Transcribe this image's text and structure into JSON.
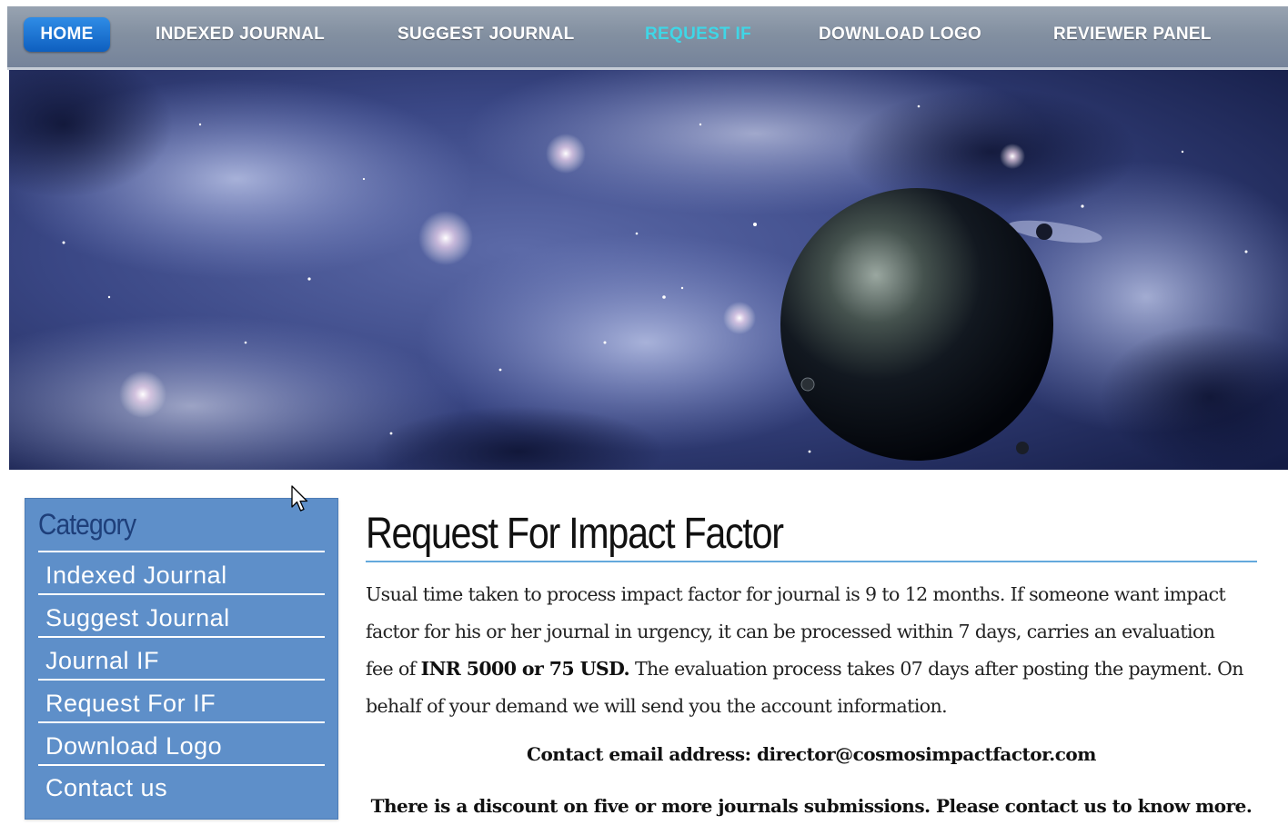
{
  "nav": {
    "items": [
      {
        "label": "HOME"
      },
      {
        "label": "INDEXED JOURNAL"
      },
      {
        "label": "SUGGEST JOURNAL"
      },
      {
        "label": "REQUEST IF"
      },
      {
        "label": "DOWNLOAD LOGO"
      },
      {
        "label": "REVIEWER PANEL"
      }
    ],
    "active_color": "#3fd6e6",
    "home_color": "#1a73d3"
  },
  "sidebar": {
    "title": "Category",
    "items": [
      {
        "label": "Indexed Journal"
      },
      {
        "label": "Suggest Journal"
      },
      {
        "label": "Journal IF"
      },
      {
        "label": "Request For IF"
      },
      {
        "label": "Download Logo"
      },
      {
        "label": "Contact us"
      }
    ],
    "background": "#5e8fc9"
  },
  "main": {
    "title": "Request For Impact Factor",
    "paragraph_part1": "Usual time taken to process impact factor for journal is 9 to 12 months. If someone want impact factor for his or her journal in urgency, it can be processed within 7 days, carries an evaluation fee of ",
    "fee": "INR 5000 or 75 USD.",
    "paragraph_part2": " The evaluation process takes 07 days after posting the payment. On behalf of your demand we will send you the account information.",
    "contact_line": "Contact email address: director@cosmosimpactfactor.com",
    "discount_line": "There is a discount on five or more journals submissions. Please contact us to know more."
  }
}
